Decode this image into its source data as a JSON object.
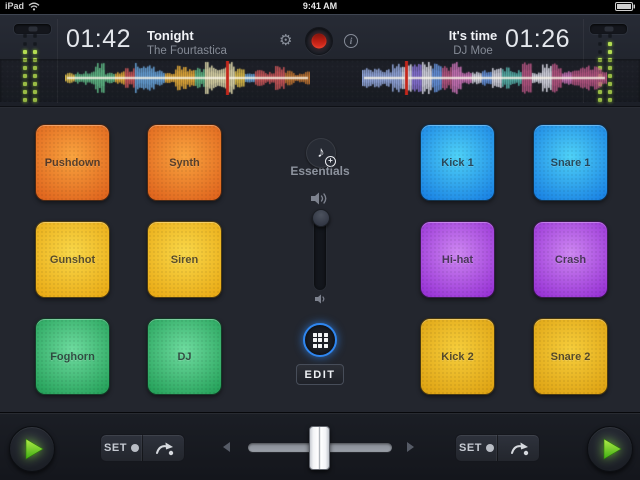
{
  "status_bar": {
    "carrier": "iPad",
    "time": "9:41 AM"
  },
  "deck_left": {
    "time": "01:42",
    "title": "Tonight",
    "artist": "The Fourtastica",
    "meter": [
      {
        "off": 2,
        "on": 7
      },
      {
        "off": 2,
        "on": 7
      }
    ]
  },
  "deck_right": {
    "time": "01:26",
    "title": "It's time",
    "artist": "DJ Moe",
    "meter": [
      {
        "off": 3,
        "on": 6
      },
      {
        "off": 1,
        "on": 8
      }
    ]
  },
  "waveforms": {
    "left": {
      "seed": 7,
      "playhead": 0.66,
      "palette": [
        "#e6c34a",
        "#f0b238",
        "#d4585a",
        "#6aa8e0",
        "#62c08a",
        "#e8e0b0",
        "#c87830"
      ]
    },
    "right": {
      "seed": 41,
      "playhead": 0.18,
      "palette": [
        "#d478c0",
        "#8f78e0",
        "#6a9ae8",
        "#e2e2ee",
        "#58b8b0",
        "#c05888",
        "#9ab0e8"
      ]
    }
  },
  "sample_bank": {
    "pack_label": "Essentials",
    "edit_label": "EDIT",
    "left_pads": [
      {
        "label": "Pushdown",
        "color": "orange"
      },
      {
        "label": "Synth",
        "color": "orange"
      },
      {
        "label": "Gunshot",
        "color": "yellow"
      },
      {
        "label": "Siren",
        "color": "yellow"
      },
      {
        "label": "Foghorn",
        "color": "green"
      },
      {
        "label": "DJ",
        "color": "green"
      }
    ],
    "right_pads": [
      {
        "label": "Kick 1",
        "color": "blue"
      },
      {
        "label": "Snare 1",
        "color": "blue"
      },
      {
        "label": "Hi-hat",
        "color": "purple"
      },
      {
        "label": "Crash",
        "color": "purple"
      },
      {
        "label": "Kick 2",
        "color": "gold"
      },
      {
        "label": "Snare 2",
        "color": "gold"
      }
    ]
  },
  "pad_colors": {
    "orange": {
      "light": "#f9a43f",
      "dark": "#e0661e"
    },
    "yellow": {
      "light": "#f9d84a",
      "dark": "#eaac17"
    },
    "green": {
      "light": "#6fdca0",
      "dark": "#27a35c"
    },
    "blue": {
      "light": "#4fd2f7",
      "dark": "#1b84e4"
    },
    "purple": {
      "light": "#ce88f2",
      "dark": "#9934d6"
    },
    "gold": {
      "light": "#f6ce3c",
      "dark": "#dfa414"
    }
  },
  "bottom_bar": {
    "set_label": "SET"
  },
  "accent_colors": {
    "record_red": "#d2281e",
    "grid_ring_blue": "#2f86f0",
    "play_green": "#7edc30",
    "meter_green": "#b4dc52",
    "playhead_red": "#c4271c"
  }
}
